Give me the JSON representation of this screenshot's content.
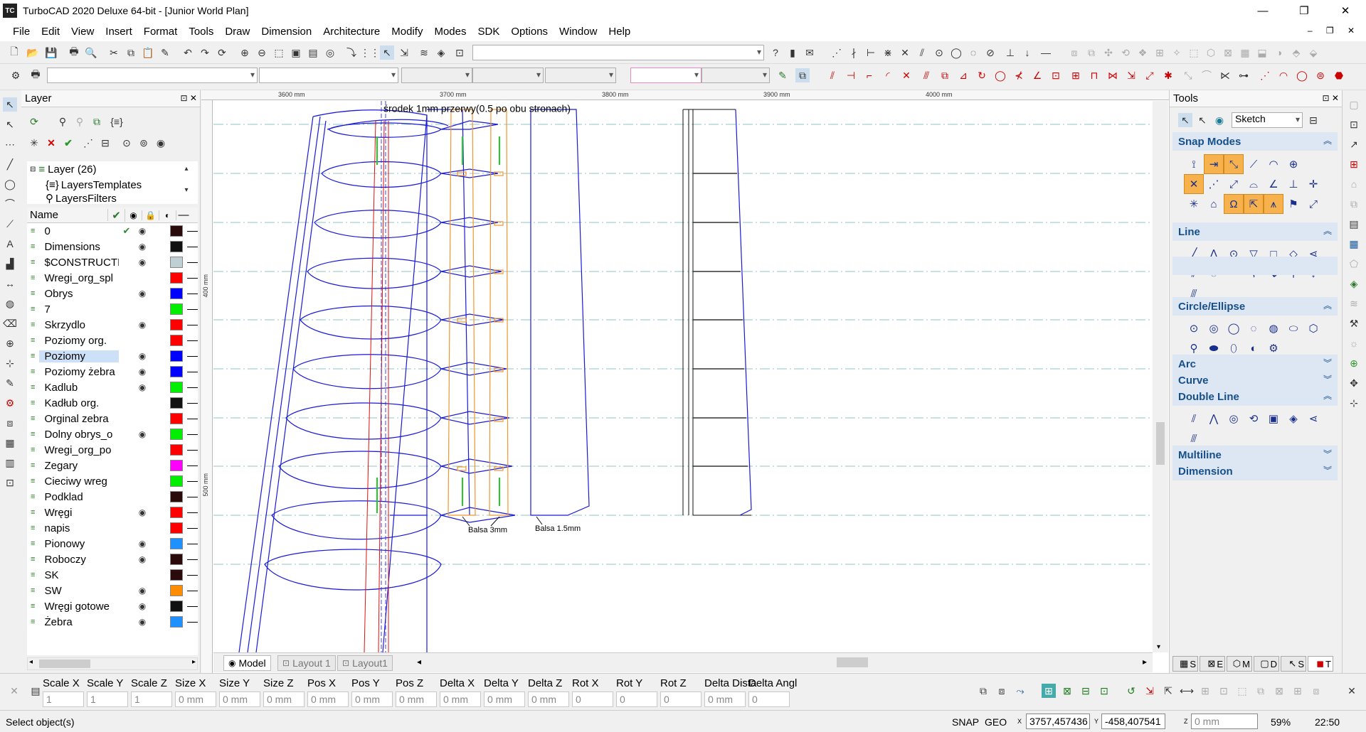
{
  "window": {
    "app_icon": "TC",
    "title": "TurboCAD 2020 Deluxe 64-bit - [Junior World Plan]",
    "buttons": [
      "minimize-icon",
      "restore-icon",
      "close-icon"
    ]
  },
  "menu": [
    "File",
    "Edit",
    "View",
    "Insert",
    "Format",
    "Tools",
    "Draw",
    "Dimension",
    "Architecture",
    "Modify",
    "Modes",
    "SDK",
    "Options",
    "Window",
    "Help"
  ],
  "layer_panel": {
    "title": "Layer",
    "tree": [
      "Layer (26)",
      "LayersTemplates",
      "LayersFilters"
    ],
    "columns": {
      "name": "Name"
    },
    "layers": [
      {
        "name": "0",
        "current": true,
        "visible": true,
        "color": "#2a0a0a"
      },
      {
        "name": "Dimensions",
        "visible": true,
        "color": "#111111"
      },
      {
        "name": "$CONSTRUCTI",
        "visible": true,
        "color": "#c0cfd4"
      },
      {
        "name": "Wregi_org_spl",
        "visible": false,
        "color": "#ff0000"
      },
      {
        "name": "Obrys",
        "visible": true,
        "color": "#0000ff"
      },
      {
        "name": "7",
        "visible": false,
        "color": "#00ee00"
      },
      {
        "name": "Skrzydlo",
        "visible": true,
        "color": "#ff0000"
      },
      {
        "name": "Poziomy org.",
        "visible": false,
        "color": "#ff0000"
      },
      {
        "name": "Poziomy",
        "visible": true,
        "color": "#0000ff",
        "selected": true
      },
      {
        "name": "Poziomy żebra",
        "visible": true,
        "color": "#0000ff"
      },
      {
        "name": "Kadlub",
        "visible": true,
        "color": "#00ee00"
      },
      {
        "name": "Kadłub org.",
        "visible": false,
        "color": "#111111"
      },
      {
        "name": "Orginal zebra",
        "visible": false,
        "color": "#ff0000"
      },
      {
        "name": "Dolny obrys_o",
        "visible": true,
        "color": "#00ee00"
      },
      {
        "name": "Wregi_org_po",
        "visible": false,
        "color": "#ff0000"
      },
      {
        "name": "Zegary",
        "visible": false,
        "color": "#ff00ff"
      },
      {
        "name": "Cieciwy wreg",
        "visible": false,
        "color": "#00ee00"
      },
      {
        "name": "Podklad",
        "visible": false,
        "color": "#2a0a0a"
      },
      {
        "name": "Wręgi",
        "visible": true,
        "color": "#ff0000"
      },
      {
        "name": "napis",
        "visible": false,
        "color": "#ff0000"
      },
      {
        "name": "Pionowy",
        "visible": true,
        "color": "#1e90ff"
      },
      {
        "name": "Roboczy",
        "visible": true,
        "color": "#2a0a0a"
      },
      {
        "name": "SK",
        "visible": false,
        "color": "#2a0a0a"
      },
      {
        "name": "SW",
        "visible": true,
        "color": "#ff8c00"
      },
      {
        "name": "Wręgi gotowe",
        "visible": true,
        "color": "#111111"
      },
      {
        "name": "Żebra",
        "visible": true,
        "color": "#1e90ff"
      }
    ]
  },
  "rulers": {
    "h_ticks": [
      "3600 mm",
      "3700 mm",
      "3800 mm",
      "3900 mm",
      "4000 mm"
    ],
    "v_ticks": [
      "400 mm",
      "500 mm"
    ]
  },
  "drawing": {
    "note_top": "środek 1mm przerwy(0.5 po obu stronach)",
    "label_balsa3": "Balsa 3mm",
    "label_balsa15": "Balsa 1.5mm"
  },
  "tabs": [
    "Model",
    "Layout 1",
    "Layout1"
  ],
  "tools_panel": {
    "title": "Tools",
    "mode_select": "Sketch",
    "sections": [
      "Snap Modes",
      "Line",
      "Circle/Ellipse",
      "Arc",
      "Curve",
      "Double Line",
      "Multiline",
      "Dimension"
    ],
    "bottom_tabs": [
      "S",
      "E",
      "M",
      "D",
      "S",
      "T"
    ]
  },
  "inspector": {
    "fields": [
      {
        "label": "Scale X",
        "value": "1"
      },
      {
        "label": "Scale Y",
        "value": "1"
      },
      {
        "label": "Scale Z",
        "value": "1"
      },
      {
        "label": "Size X",
        "value": "0 mm"
      },
      {
        "label": "Size Y",
        "value": "0 mm"
      },
      {
        "label": "Size Z",
        "value": "0 mm"
      },
      {
        "label": "Pos X",
        "value": "0 mm"
      },
      {
        "label": "Pos Y",
        "value": "0 mm"
      },
      {
        "label": "Pos Z",
        "value": "0 mm"
      },
      {
        "label": "Delta X",
        "value": "0 mm"
      },
      {
        "label": "Delta Y",
        "value": "0 mm"
      },
      {
        "label": "Delta Z",
        "value": "0 mm"
      },
      {
        "label": "Rot X",
        "value": "0"
      },
      {
        "label": "Rot Y",
        "value": "0"
      },
      {
        "label": "Rot Z",
        "value": "0"
      },
      {
        "label": "Delta Dista",
        "value": "0 mm"
      },
      {
        "label": "Delta Angl",
        "value": "0"
      }
    ]
  },
  "status": {
    "message": "Select object(s)",
    "snap": "SNAP",
    "geo": "GEO",
    "x": "3757,457436",
    "y": "-458,407541",
    "z": "0 mm",
    "zoom": "59%",
    "time": "22:50"
  }
}
